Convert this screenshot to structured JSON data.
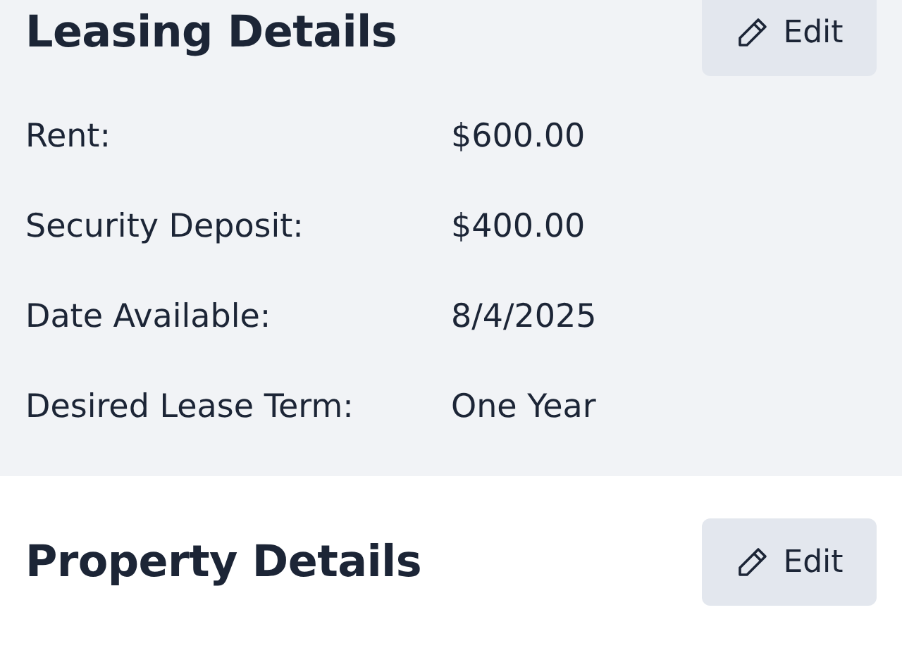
{
  "sections": [
    {
      "title": "Leasing Details",
      "button": "Edit",
      "tinted": true,
      "rows": [
        {
          "label": "Rent:",
          "value": "$600.00"
        },
        {
          "label": "Security Deposit:",
          "value": "$400.00"
        },
        {
          "label": "Date Available:",
          "value": "8/4/2025"
        },
        {
          "label": "Desired Lease Term:",
          "value": "One Year"
        }
      ]
    },
    {
      "title": "Property Details",
      "button": "Edit",
      "tinted": false
    }
  ]
}
